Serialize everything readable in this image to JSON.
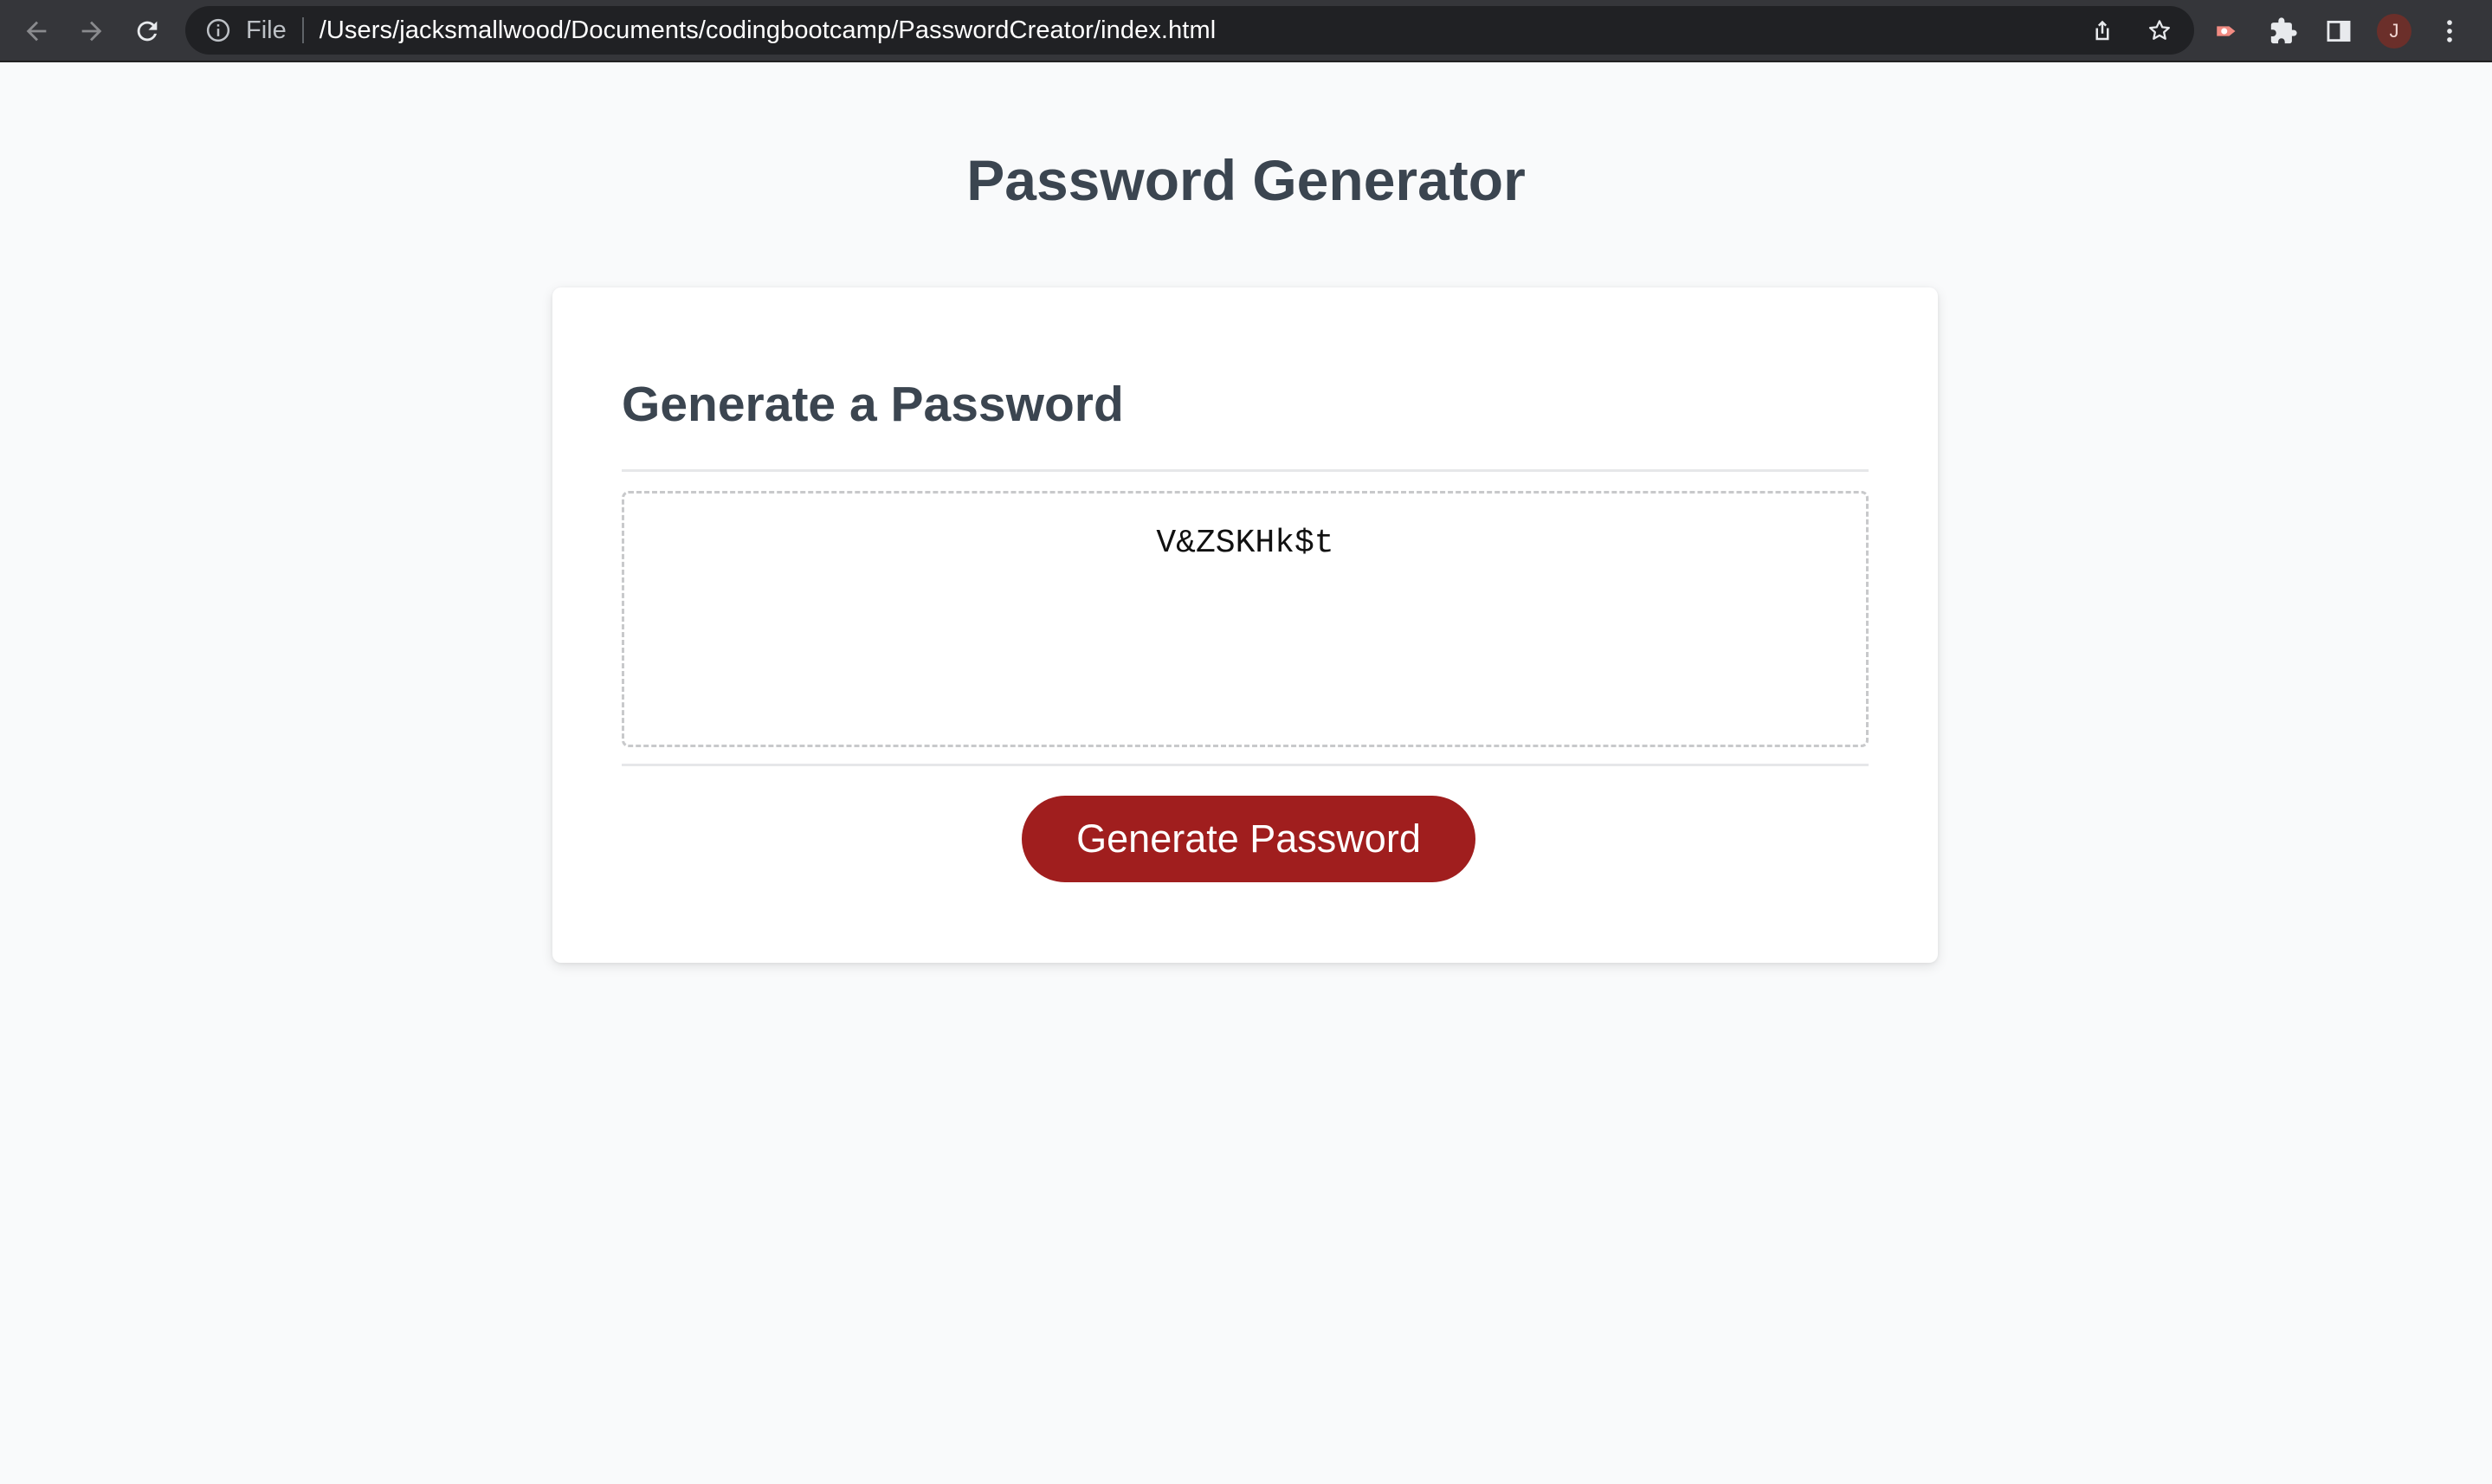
{
  "browser": {
    "scheme_label": "File",
    "url": "/Users/jacksmallwood/Documents/codingbootcamp/PasswordCreator/index.html",
    "avatar_initial": "J",
    "icons": [
      "back-arrow-icon",
      "forward-arrow-icon",
      "reload-icon",
      "info-icon",
      "share-icon",
      "star-icon",
      "extension-record-icon",
      "puzzle-icon",
      "side-panel-icon",
      "more-vert-icon"
    ],
    "colors": {
      "toolbar_bg": "#35363a",
      "omnibox_bg": "#202124",
      "avatar_bg": "#6b2f2a"
    }
  },
  "page": {
    "title": "Password Generator"
  },
  "card": {
    "title": "Generate a Password",
    "password_value": "V&ZSKHk$t",
    "button_label": "Generate Password"
  },
  "colors": {
    "page_bg": "#f9fafb",
    "heading": "#3b4550",
    "button_bg": "#a01e1e",
    "button_text": "#ffffff"
  }
}
